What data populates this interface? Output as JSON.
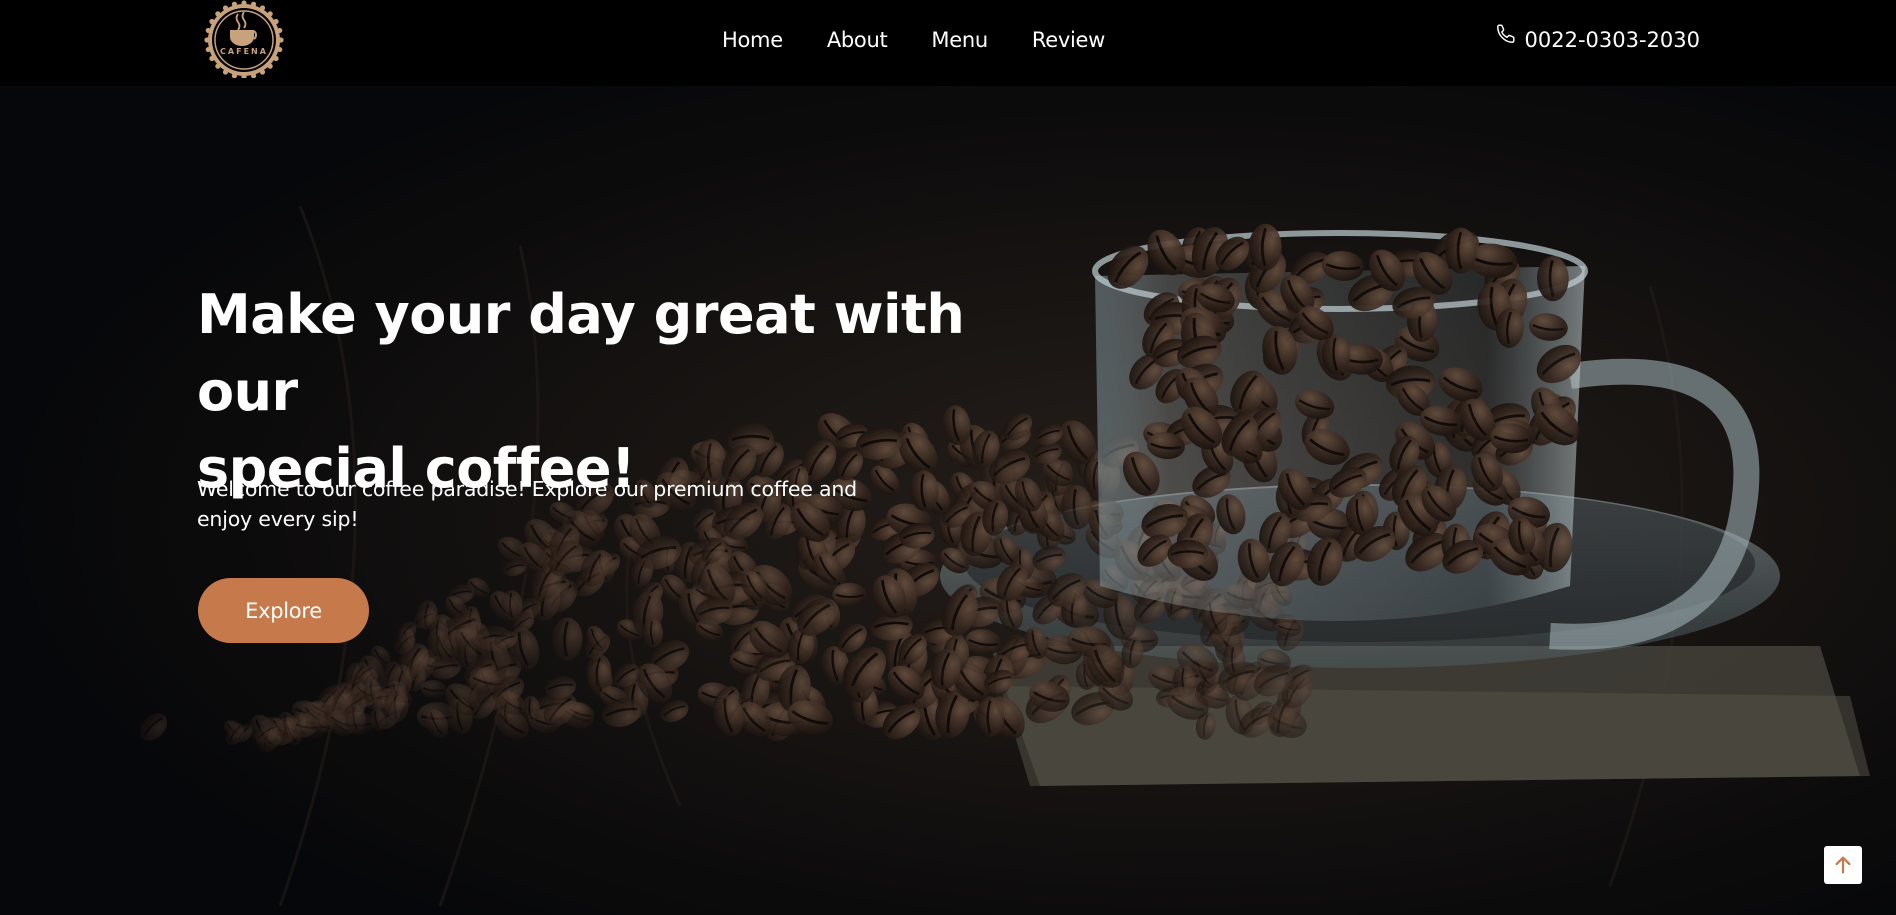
{
  "brand": {
    "logo_text": "CAFENA",
    "accent": "#c6794a"
  },
  "nav": {
    "items": [
      {
        "label": "Home"
      },
      {
        "label": "About"
      },
      {
        "label": "Menu"
      },
      {
        "label": "Review"
      }
    ]
  },
  "contact": {
    "icon": "phone-icon",
    "phone": "0022-0303-2030"
  },
  "hero": {
    "title_line1": "Make your day great with our",
    "title_line2": "special coffee!",
    "subtitle_line1": "Welcome to our coffee paradise! Explore our premium coffee and",
    "subtitle_line2": "enjoy every sip!",
    "cta_label": "Explore"
  },
  "scroll_top": {
    "icon": "arrow-up-icon",
    "color": "#c6794a"
  }
}
